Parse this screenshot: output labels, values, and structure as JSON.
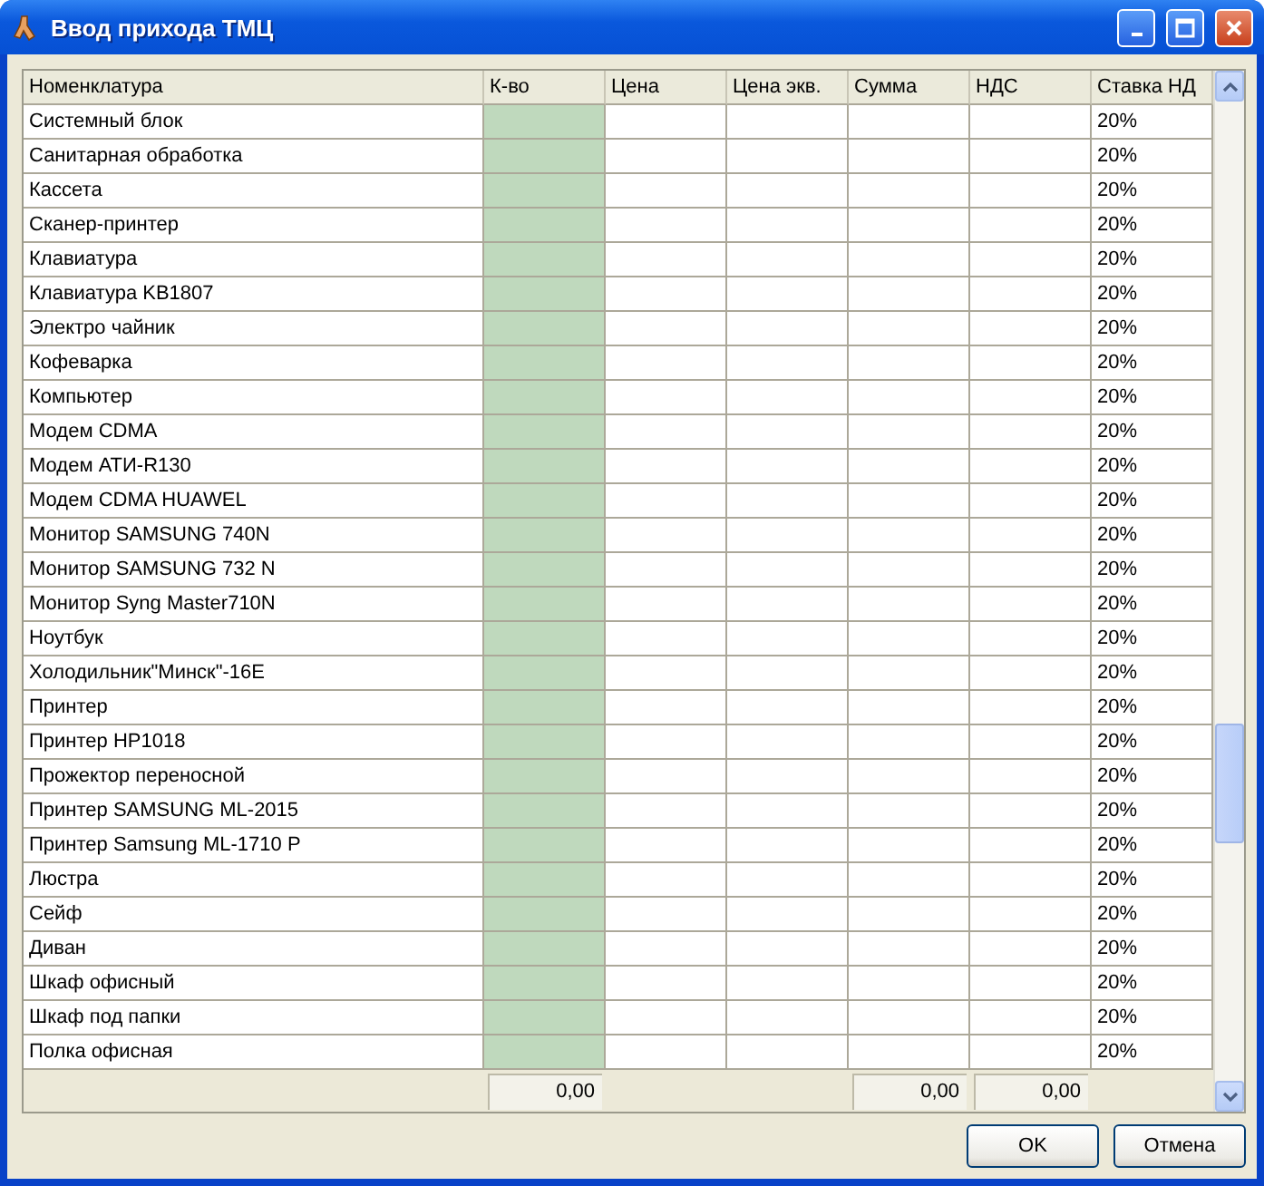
{
  "window": {
    "title": "Ввод прихода ТМЦ"
  },
  "table": {
    "columns": [
      "Номенклатура",
      "К-во",
      "Цена",
      "Цена экв.",
      "Сумма",
      "НДС",
      "Ставка НД"
    ],
    "rows": [
      {
        "name": "Системный блок",
        "rate": "20%"
      },
      {
        "name": "Санитарная обработка",
        "rate": "20%"
      },
      {
        "name": "Кассета",
        "rate": "20%"
      },
      {
        "name": "Сканер-принтер",
        "rate": "20%"
      },
      {
        "name": "Клавиатура",
        "rate": "20%"
      },
      {
        "name": "Клавиатура KB1807",
        "rate": "20%"
      },
      {
        "name": "Электро чайник",
        "rate": "20%"
      },
      {
        "name": "Кофеварка",
        "rate": "20%"
      },
      {
        "name": "Компьютер",
        "rate": "20%"
      },
      {
        "name": "Модем CDMA",
        "rate": "20%"
      },
      {
        "name": "Модем АТИ-R130",
        "rate": "20%"
      },
      {
        "name": "Модем CDMA HUAWEL",
        "rate": "20%"
      },
      {
        "name": "Монитор SAMSUNG 740N",
        "rate": "20%"
      },
      {
        "name": "Монитор SAMSUNG 732 N",
        "rate": "20%"
      },
      {
        "name": "Монитор Syng Master710N",
        "rate": "20%"
      },
      {
        "name": "Ноутбук",
        "rate": "20%"
      },
      {
        "name": "Холодильник\"Минск\"-16Е",
        "rate": "20%"
      },
      {
        "name": "Принтер",
        "rate": "20%"
      },
      {
        "name": "Принтер HP1018",
        "rate": "20%"
      },
      {
        "name": "Прожектор переносной",
        "rate": "20%"
      },
      {
        "name": "Принтер SAMSUNG ML-2015",
        "rate": "20%"
      },
      {
        "name": "Принтер Samsung ML-1710 P",
        "rate": "20%"
      },
      {
        "name": "Люстра",
        "rate": "20%"
      },
      {
        "name": "Сейф",
        "rate": "20%"
      },
      {
        "name": "Диван",
        "rate": "20%"
      },
      {
        "name": "Шкаф офисный",
        "rate": "20%"
      },
      {
        "name": "Шкаф под папки",
        "rate": "20%"
      },
      {
        "name": "Полка офисная",
        "rate": "20%"
      }
    ],
    "totals": {
      "quantity": "0,00",
      "sum": "0,00",
      "vat": "0,00"
    }
  },
  "buttons": [
    {
      "label": "OK"
    },
    {
      "label": "Отмена"
    }
  ]
}
